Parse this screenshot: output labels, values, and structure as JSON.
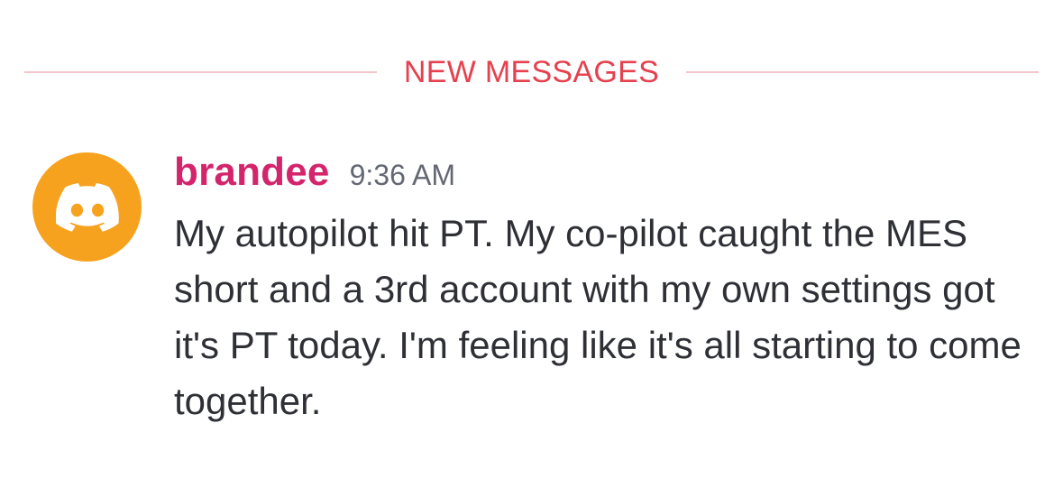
{
  "divider": {
    "label": "NEW MESSAGES",
    "color": "#e5414e"
  },
  "message": {
    "avatar_icon": "discord-logo-icon",
    "avatar_color": "#f6a21f",
    "username": "brandee",
    "username_color": "#d3246c",
    "timestamp": "9:36 AM",
    "text": "My autopilot hit PT. My co-pilot caught the MES short and a 3rd account with my own settings got it's PT today. I'm feeling like it's all starting to come together."
  }
}
